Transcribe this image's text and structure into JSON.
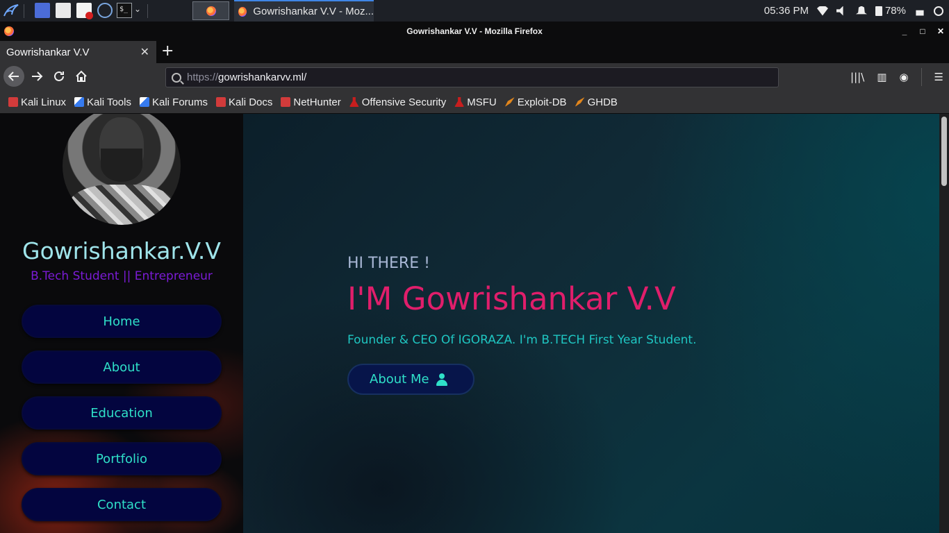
{
  "taskbar": {
    "task_title": "Gowrishankar V.V - Moz...",
    "time": "05:36 PM",
    "battery": "78%"
  },
  "window": {
    "title": "Gowrishankar V.V - Mozilla Firefox",
    "controls": [
      "_",
      "□",
      "✕"
    ]
  },
  "tabs": [
    {
      "label": "Gowrishankar V.V"
    }
  ],
  "navbar": {
    "url_scheme": "https://",
    "url_host": "gowrishankarvv.ml/"
  },
  "bookmarks": [
    {
      "label": "Kali Linux",
      "icon": "kali-icon"
    },
    {
      "label": "Kali Tools",
      "icon": "kali-tools-icon"
    },
    {
      "label": "Kali Forums",
      "icon": "kali-forums-icon"
    },
    {
      "label": "Kali Docs",
      "icon": "kali-docs-icon"
    },
    {
      "label": "NetHunter",
      "icon": "nethunter-icon"
    },
    {
      "label": "Offensive Security",
      "icon": "offsec-icon"
    },
    {
      "label": "MSFU",
      "icon": "msfu-icon"
    },
    {
      "label": "Exploit-DB",
      "icon": "exploitdb-icon"
    },
    {
      "label": "GHDB",
      "icon": "ghdb-icon"
    }
  ],
  "sidebar": {
    "name": "Gowrishankar.V.V",
    "role": "B.Tech Student || Entrepreneur",
    "items": [
      {
        "label": "Home"
      },
      {
        "label": "About"
      },
      {
        "label": "Education"
      },
      {
        "label": "Portfolio"
      },
      {
        "label": "Contact"
      }
    ]
  },
  "hero": {
    "greeting": "HI THERE !",
    "headline": "I'M Gowrishankar V.V",
    "tagline": "Founder & CEO Of IGORAZA. I'm B.TECH First Year Student.",
    "button_label": "About Me"
  },
  "colors": {
    "accent_teal": "#2fe0c8",
    "headline_pink": "#e01e6b",
    "name_cyan": "#9fe4ea",
    "role_purple": "#7b1bd6",
    "button_navy": "#03053f"
  }
}
